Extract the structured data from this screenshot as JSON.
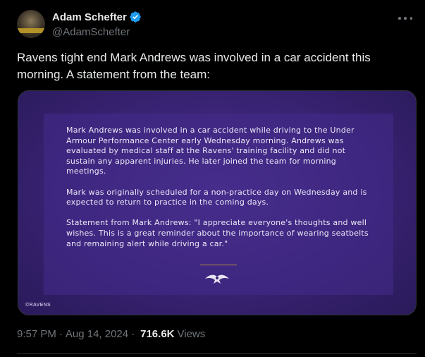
{
  "author": {
    "display_name": "Adam Schefter",
    "handle": "@AdamSchefter",
    "verified_icon": "verified-badge-icon",
    "accent_color": "#1d9bf0"
  },
  "tweet": {
    "text": "Ravens tight end Mark Andrews was involved in a car accident this morning. A statement from the team:"
  },
  "media": {
    "paragraphs": [
      "Mark Andrews was involved in a car accident while driving to the Under Armour Performance Center early Wednesday morning. Andrews was evaluated by medical staff at the Ravens' training facility and did not sustain any apparent injuries. He later joined the team for morning meetings.",
      "Mark was originally scheduled for a non-practice day on Wednesday and is expected to return to practice in the coming days.",
      "Statement from Mark Andrews: \"I appreciate everyone's thoughts and well wishes. This is a great reminder about the importance of wearing seatbelts and remaining alert while driving a car.\""
    ],
    "watermark": "©RAVENS",
    "logo_icon": "ravens-logo-icon"
  },
  "meta": {
    "time": "9:57 PM",
    "date": "Aug 14, 2024",
    "separator": "·",
    "views_count": "716.6K",
    "views_label": "Views"
  }
}
